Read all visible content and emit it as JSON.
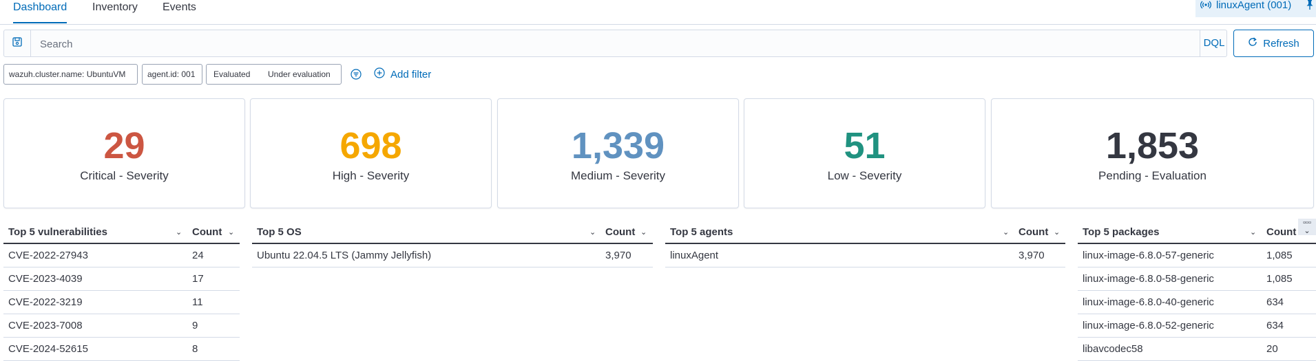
{
  "tabs": [
    {
      "label": "Dashboard"
    },
    {
      "label": "Inventory"
    },
    {
      "label": "Events"
    }
  ],
  "agent_pill": {
    "label": "linuxAgent (001)",
    "icon": "broadcast-icon",
    "pin_icon": "pin-icon"
  },
  "search": {
    "placeholder": "Search",
    "language": "DQL",
    "refresh_label": "Refresh"
  },
  "filters": [
    {
      "label": "wazuh.cluster.name: UbuntuVM"
    },
    {
      "label": "agent.id: 001"
    },
    {
      "label": "Evaluated"
    },
    {
      "label": "Under evaluation"
    }
  ],
  "add_filter": {
    "label": "Add filter"
  },
  "stats": [
    {
      "value": "29",
      "label": "Critical - Severity",
      "color": "#cc5642"
    },
    {
      "value": "698",
      "label": "High - Severity",
      "color": "#f5a700"
    },
    {
      "value": "1,339",
      "label": "Medium - Severity",
      "color": "#6092c0"
    },
    {
      "value": "51",
      "label": "Low - Severity",
      "color": "#209280"
    },
    {
      "value": "1,853",
      "label": "Pending - Evaluation",
      "color": "#343741"
    }
  ],
  "tables": [
    {
      "title": "Top 5 vulnerabilities",
      "count_label": "Count",
      "rows": [
        {
          "name": "CVE-2022-27943",
          "count": "24"
        },
        {
          "name": "CVE-2023-4039",
          "count": "17"
        },
        {
          "name": "CVE-2022-3219",
          "count": "11"
        },
        {
          "name": "CVE-2023-7008",
          "count": "9"
        },
        {
          "name": "CVE-2024-52615",
          "count": "8"
        }
      ]
    },
    {
      "title": "Top 5 OS",
      "count_label": "Count",
      "rows": [
        {
          "name": "Ubuntu 22.04.5 LTS (Jammy Jellyfish)",
          "count": "3,970"
        }
      ]
    },
    {
      "title": "Top 5 agents",
      "count_label": "Count",
      "rows": [
        {
          "name": "linuxAgent",
          "count": "3,970"
        }
      ]
    },
    {
      "title": "Top 5 packages",
      "count_label": "Count",
      "rows": [
        {
          "name": "linux-image-6.8.0-57-generic",
          "count": "1,085"
        },
        {
          "name": "linux-image-6.8.0-58-generic",
          "count": "1,085"
        },
        {
          "name": "linux-image-6.8.0-40-generic",
          "count": "634"
        },
        {
          "name": "linux-image-6.8.0-52-generic",
          "count": "634"
        },
        {
          "name": "libavcodec58",
          "count": "20"
        }
      ]
    }
  ]
}
